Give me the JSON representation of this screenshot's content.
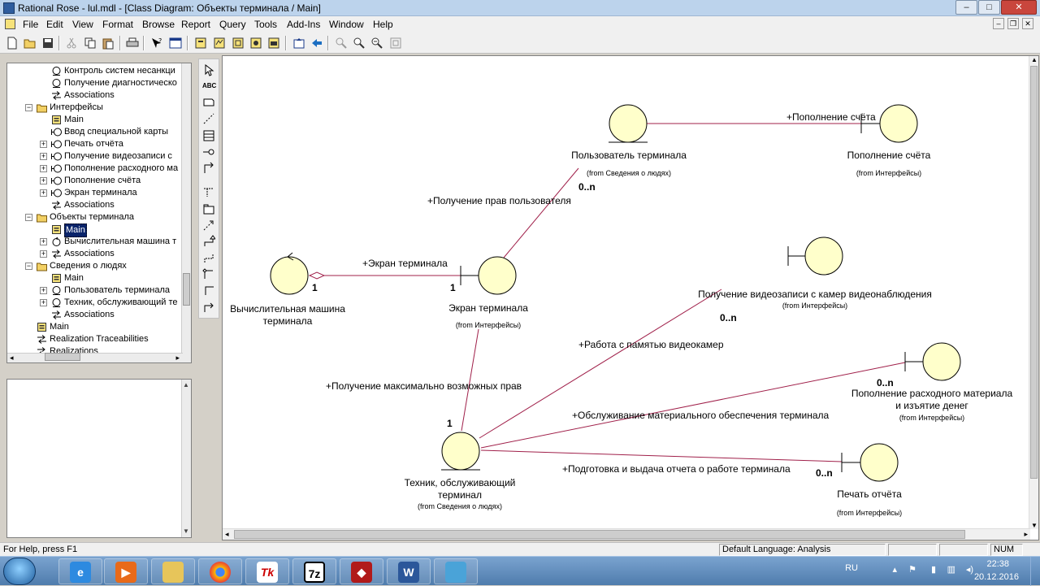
{
  "window": {
    "title": "Rational Rose - lul.mdl - [Class Diagram: Объекты терминала / Main]",
    "buttons": [
      "–",
      "□",
      "✕"
    ]
  },
  "menu": [
    "File",
    "Edit",
    "View",
    "Format",
    "Browse",
    "Report",
    "Query",
    "Tools",
    "Add-Ins",
    "Window",
    "Help"
  ],
  "browser": {
    "items": [
      {
        "label": "Контроль систем несанкци",
        "icon": "entity-icon",
        "level": 3,
        "expander": ""
      },
      {
        "label": "Получение диагностическо",
        "icon": "entity-icon",
        "level": 3,
        "expander": ""
      },
      {
        "label": "Associations",
        "icon": "associations-icon",
        "level": 3,
        "expander": ""
      },
      {
        "label": "Интерфейсы",
        "icon": "folder-icon",
        "level": 2,
        "expander": "-"
      },
      {
        "label": "Main",
        "icon": "diagram-icon",
        "level": 3,
        "expander": ""
      },
      {
        "label": "Ввод специальной карты",
        "icon": "boundary-icon",
        "level": 3,
        "expander": ""
      },
      {
        "label": "Печать отчёта",
        "icon": "boundary-icon",
        "level": 3,
        "expander": "+"
      },
      {
        "label": "Получение видеозаписи с",
        "icon": "boundary-icon",
        "level": 3,
        "expander": "+"
      },
      {
        "label": "Пополнение расходного ма",
        "icon": "boundary-icon",
        "level": 3,
        "expander": "+"
      },
      {
        "label": "Пополнение счёта",
        "icon": "boundary-icon",
        "level": 3,
        "expander": "+"
      },
      {
        "label": "Экран терминала",
        "icon": "boundary-icon",
        "level": 3,
        "expander": "+"
      },
      {
        "label": "Associations",
        "icon": "associations-icon",
        "level": 3,
        "expander": ""
      },
      {
        "label": "Объекты терминала",
        "icon": "folder-icon",
        "level": 2,
        "expander": "-"
      },
      {
        "label": "Main",
        "icon": "diagram-icon",
        "level": 3,
        "expander": "",
        "selected": true
      },
      {
        "label": "Вычислительная машина т",
        "icon": "control-icon",
        "level": 3,
        "expander": "+"
      },
      {
        "label": "Associations",
        "icon": "associations-icon",
        "level": 3,
        "expander": "+"
      },
      {
        "label": "Сведения о людях",
        "icon": "folder-icon",
        "level": 2,
        "expander": "-"
      },
      {
        "label": "Main",
        "icon": "diagram-icon",
        "level": 3,
        "expander": ""
      },
      {
        "label": "Пользователь терминала",
        "icon": "entity-icon",
        "level": 3,
        "expander": "+"
      },
      {
        "label": "Техник, обслуживающий те",
        "icon": "entity-icon",
        "level": 3,
        "expander": "+"
      },
      {
        "label": "Associations",
        "icon": "associations-icon",
        "level": 3,
        "expander": ""
      },
      {
        "label": "Main",
        "icon": "diagram-icon",
        "level": 2,
        "expander": ""
      },
      {
        "label": "Realization Traceabilities",
        "icon": "associations-icon",
        "level": 2,
        "expander": ""
      },
      {
        "label": "Realizations",
        "icon": "associations-icon",
        "level": 2,
        "expander": ""
      }
    ]
  },
  "diagram": {
    "classes": [
      {
        "id": "vm",
        "type": "control",
        "name": [
          "Вычислительная машина",
          "терминала"
        ],
        "from": ""
      },
      {
        "id": "screen",
        "type": "boundary",
        "name": [
          "Экран терминала"
        ],
        "from": "(from Интерфейсы)"
      },
      {
        "id": "user",
        "type": "entity",
        "name": [
          "Пользователь терминала"
        ],
        "from": "(from Сведения о людях)"
      },
      {
        "id": "topup",
        "type": "boundary",
        "name": [
          "Пополнение счёта"
        ],
        "from": "(from Интерфейсы)"
      },
      {
        "id": "video",
        "type": "boundary",
        "name": [
          "Получение видеозаписи с камер видеонаблюдения"
        ],
        "from": "(from Интерфейсы)"
      },
      {
        "id": "supply",
        "type": "boundary",
        "name": [
          "Пополнение расходного материала",
          "и изъятие денег"
        ],
        "from": "(from Интерфейсы)"
      },
      {
        "id": "print",
        "type": "boundary",
        "name": [
          "Печать отчёта"
        ],
        "from": "(from Интерфейсы)"
      },
      {
        "id": "tech",
        "type": "entity",
        "name": [
          "Техник, обслуживающий",
          "терминал"
        ],
        "from": "(from Сведения о людях)"
      }
    ],
    "associations": [
      {
        "label": "+Экран терминала",
        "from": "vm",
        "to": "screen",
        "mult_from": "1",
        "mult_to": "1"
      },
      {
        "label": "+Получение прав пользователя",
        "from": "screen",
        "to": "user",
        "mult_to": "0..n"
      },
      {
        "label": "+Пополнение счёта",
        "from": "user",
        "to": "topup"
      },
      {
        "label": "+Получение максимально возможных прав",
        "from": "tech",
        "to": "screen",
        "mult_from": "1"
      },
      {
        "label": "+Работа с памятью видеокамер",
        "from": "tech",
        "to": "video",
        "mult_to": "0..n"
      },
      {
        "label": "+Обслуживание материального обеспечения терминала",
        "from": "tech",
        "to": "supply",
        "mult_to": "0..n"
      },
      {
        "label": "+Подготовка и выдача отчета о работе терминала",
        "from": "tech",
        "to": "print",
        "mult_to": "0..n"
      }
    ]
  },
  "status": {
    "help": "For Help, press F1",
    "language": "Default Language: Analysis",
    "num": "NUM"
  },
  "taskbar": {
    "apps": [
      "ie-icon",
      "media-icon",
      "explorer-icon",
      "chrome-icon",
      "tk-icon",
      "7zip-icon",
      "rose-icon",
      "word-icon",
      "image-icon"
    ],
    "lang": "RU",
    "time": "22:38",
    "date": "20.12.2016"
  },
  "colors": {
    "class_fill": "#ffffcb",
    "association": "#a0204a"
  }
}
